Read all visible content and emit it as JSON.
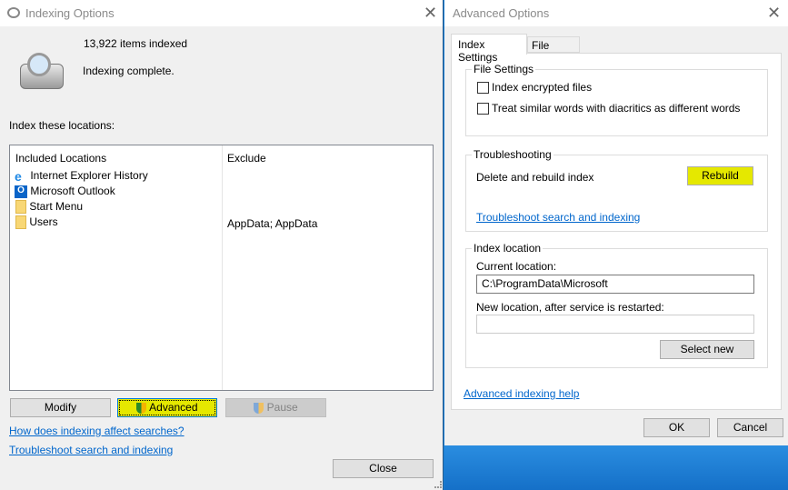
{
  "indexing_window": {
    "title": "Indexing Options",
    "items_indexed": "13,922 items indexed",
    "status": "Indexing complete.",
    "locations_label": "Index these locations:",
    "columns": {
      "included": "Included Locations",
      "exclude": "Exclude"
    },
    "locations": [
      {
        "name": "Internet Explorer History",
        "exclude": "",
        "icon": "ie-icon"
      },
      {
        "name": "Microsoft Outlook",
        "exclude": "",
        "icon": "outlook-icon"
      },
      {
        "name": "Start Menu",
        "exclude": "",
        "icon": "folder-icon"
      },
      {
        "name": "Users",
        "exclude": "AppData; AppData",
        "icon": "folder-icon"
      }
    ],
    "buttons": {
      "modify": "Modify",
      "advanced": "Advanced",
      "pause": "Pause",
      "close": "Close"
    },
    "links": {
      "how": "How does indexing affect searches?",
      "troubleshoot": "Troubleshoot search and indexing"
    }
  },
  "advanced_window": {
    "title": "Advanced Options",
    "tabs": [
      "Index Settings",
      "File Types"
    ],
    "file_settings": {
      "legend": "File Settings",
      "encrypted": "Index encrypted files",
      "diacritics": "Treat similar words with diacritics as different words"
    },
    "troubleshooting": {
      "legend": "Troubleshooting",
      "rebuild_label": "Delete and rebuild index",
      "rebuild_button": "Rebuild",
      "link": "Troubleshoot search and indexing"
    },
    "index_location": {
      "legend": "Index location",
      "current_label": "Current location:",
      "current_value": "C:\\ProgramData\\Microsoft",
      "new_label": "New location, after service is restarted:",
      "new_value": "",
      "select_new": "Select new"
    },
    "help_link": "Advanced indexing help",
    "ok": "OK",
    "cancel": "Cancel"
  },
  "colors": {
    "highlight": "#e5e800",
    "link": "#0066cc",
    "desktop": "#1a7fd4"
  }
}
